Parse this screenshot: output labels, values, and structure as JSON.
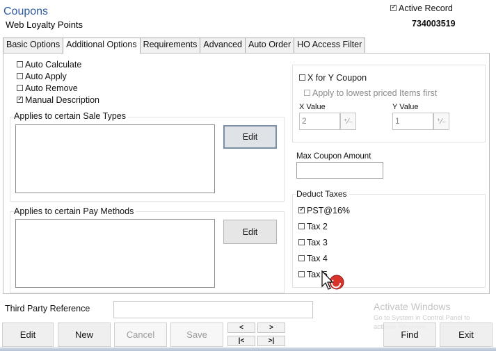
{
  "header": {
    "title": "Coupons",
    "subtitle": "Web Loyalty Points",
    "active_record_label": "Active Record",
    "active_record_checked": true,
    "record_id": "734003519"
  },
  "tabs": [
    {
      "label": "Basic Options",
      "active": false
    },
    {
      "label": "Additional Options",
      "active": true
    },
    {
      "label": "Requirements",
      "active": false
    },
    {
      "label": "Advanced",
      "active": false
    },
    {
      "label": "Auto Order",
      "active": false
    },
    {
      "label": "HO Access Filter",
      "active": false
    }
  ],
  "options": [
    {
      "label": "Auto Calculate",
      "checked": false
    },
    {
      "label": "Auto Apply",
      "checked": false
    },
    {
      "label": "Auto Remove",
      "checked": false
    },
    {
      "label": "Manual Description",
      "checked": true
    }
  ],
  "sale_types": {
    "label": "Applies to certain Sale Types",
    "edit_label": "Edit"
  },
  "pay_methods": {
    "label": "Applies to certain Pay Methods",
    "edit_label": "Edit"
  },
  "x_for_y": {
    "label": "X for Y Coupon",
    "checked": false,
    "lowest_label": "Apply to lowest priced Items first",
    "x_label": "X Value",
    "x_value": "2",
    "y_label": "Y Value",
    "y_value": "1"
  },
  "max_coupon": {
    "label": "Max Coupon Amount",
    "value": ""
  },
  "deduct_taxes": {
    "label": "Deduct Taxes",
    "items": [
      {
        "label": "PST@16%",
        "checked": true
      },
      {
        "label": "Tax 2",
        "checked": false
      },
      {
        "label": "Tax 3",
        "checked": false
      },
      {
        "label": "Tax 4",
        "checked": false
      },
      {
        "label": "Tax 5",
        "checked": false
      }
    ]
  },
  "third_party": {
    "label": "Third Party Reference",
    "value": ""
  },
  "buttons": {
    "edit": "Edit",
    "new": "New",
    "cancel": "Cancel",
    "save": "Save",
    "find": "Find",
    "exit": "Exit",
    "prev": "<",
    "next": ">",
    "first": "|<",
    "last": ">|"
  },
  "watermark": {
    "title": "Activate Windows",
    "subtitle": "Go to System in Control Panel to activate Windows."
  }
}
